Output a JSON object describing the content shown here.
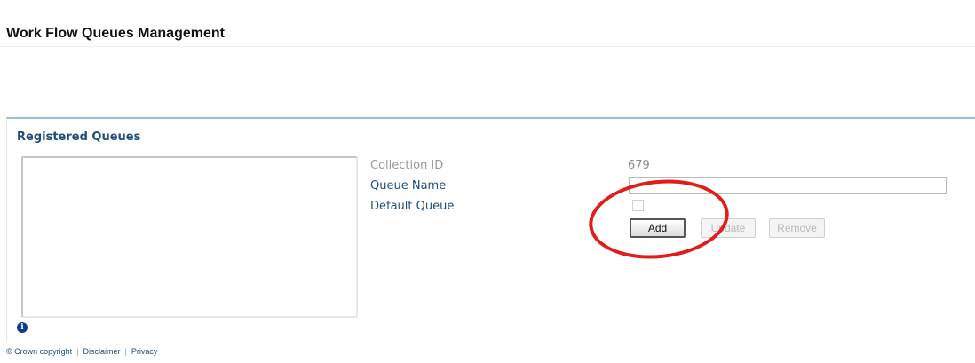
{
  "page": {
    "title": "Work Flow Queues Management"
  },
  "registered_queues": {
    "heading": "Registered Queues",
    "items": []
  },
  "form": {
    "collection_id_label": "Collection ID",
    "collection_id_value": "679",
    "queue_name_label": "Queue Name",
    "queue_name_value": "",
    "default_queue_label": "Default Queue",
    "default_queue_checked": false
  },
  "buttons": {
    "add": "Add",
    "update": "Update",
    "remove": "Remove"
  },
  "info_icon": {
    "glyph": "i",
    "icon": "info-icon"
  },
  "annotation": {
    "color": "#e21b1b"
  },
  "footer": {
    "copyright": "© Crown copyright",
    "disclaimer": "Disclaimer",
    "privacy": "Privacy",
    "separator": "|"
  },
  "colors": {
    "heading_blue": "#1f4e79",
    "panel_border": "#9fbcd8"
  }
}
